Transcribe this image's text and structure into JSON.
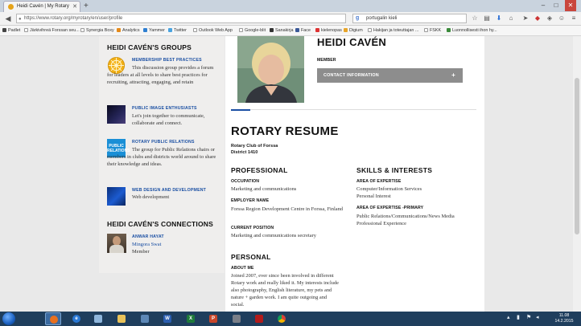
{
  "browser": {
    "tab_title": "Heidi Cavén | My Rotary",
    "url": "https://www.rotary.org/myrotary/en/user/profile",
    "search_value": "portugalin kieli",
    "bookmarks": [
      "Padlet",
      "Järkivihreä Forssan seu...",
      "Synergia Boxy",
      "Analytics",
      "Yammer",
      "Twitter",
      "Outlook Web App",
      "Google-blit",
      "Sanakirja",
      "Face",
      "kielenopas",
      "Digium",
      "Hakijan ja toteuttajan ...",
      "FSKK",
      "Luonnollisesti ihon hy..."
    ]
  },
  "groups": {
    "title": "HEIDI CAVÉN'S GROUPS",
    "items": [
      {
        "name": "MEMBERSHIP BEST PRACTICES",
        "desc": "This discussion group provides a forum for leaders at all levels to share best practices for recruiting, attracting, engaging, and retain"
      },
      {
        "name": "PUBLIC IMAGE ENTHUSIASTS",
        "desc": "Let's join together to communicate, collaborate and connect."
      },
      {
        "name": "ROTARY PUBLIC RELATIONS",
        "desc": "The group for Public Relations chairs or members in clubs and districts world around to share their knowledge and ideas.",
        "icon_text": "PUBLIC RELATIONS"
      },
      {
        "name": "WEB DESIGN AND DEVELOPMENT",
        "desc": "Web development"
      }
    ]
  },
  "connections": {
    "title": "HEIDI CAVÉN'S CONNECTIONS",
    "items": [
      {
        "name": "ANWAR HAYAT",
        "club": "Mingora Swat",
        "role": "Member"
      }
    ]
  },
  "profile": {
    "name": "HEIDI CAVÉN",
    "role": "MEMBER",
    "contact_label": "CONTACT INFORMATION",
    "contact_icon": "+"
  },
  "resume": {
    "title": "ROTARY RESUME",
    "club": "Rotary Club of Forssa",
    "district": "District 1410",
    "professional": {
      "title": "PROFESSIONAL",
      "occupation_label": "OCCUPATION",
      "occupation": "Marketing and communications",
      "employer_label": "EMPLOYER NAME",
      "employer": "Forssa Region Development Centre in Forssa, Finland",
      "position_label": "CURRENT POSITION",
      "position": "Marketing and communications secretary"
    },
    "skills": {
      "title": "SKILLS & INTERESTS",
      "expertise_label": "AREA OF EXPERTISE",
      "expertise": [
        "Computer/Information Services",
        "Personal Interest"
      ],
      "primary_label": "AREA OF EXPERTISE -PRIMARY",
      "primary": [
        "Public Relations/Communications/News Media",
        "Professional Experience"
      ]
    },
    "personal": {
      "title": "PERSONAL",
      "about_label": "ABOUT ME",
      "about": "Joined 2007, ever since been involved in different Rotary work and really liked it. My interests include also photography, English literature, my pets and nature + garden work. I am quite outgoing and social."
    }
  },
  "taskbar": {
    "time": "11.08",
    "date": "14.2.2015",
    "apps": [
      "firefox",
      "explorer",
      "folder",
      "word",
      "excel",
      "powerpoint",
      "tool",
      "acrobat",
      "chrome"
    ]
  },
  "colors": {
    "accent": "#1a4fa3",
    "contact_bar": "#8d8d8d",
    "taskbar": "#1f3e5d"
  }
}
